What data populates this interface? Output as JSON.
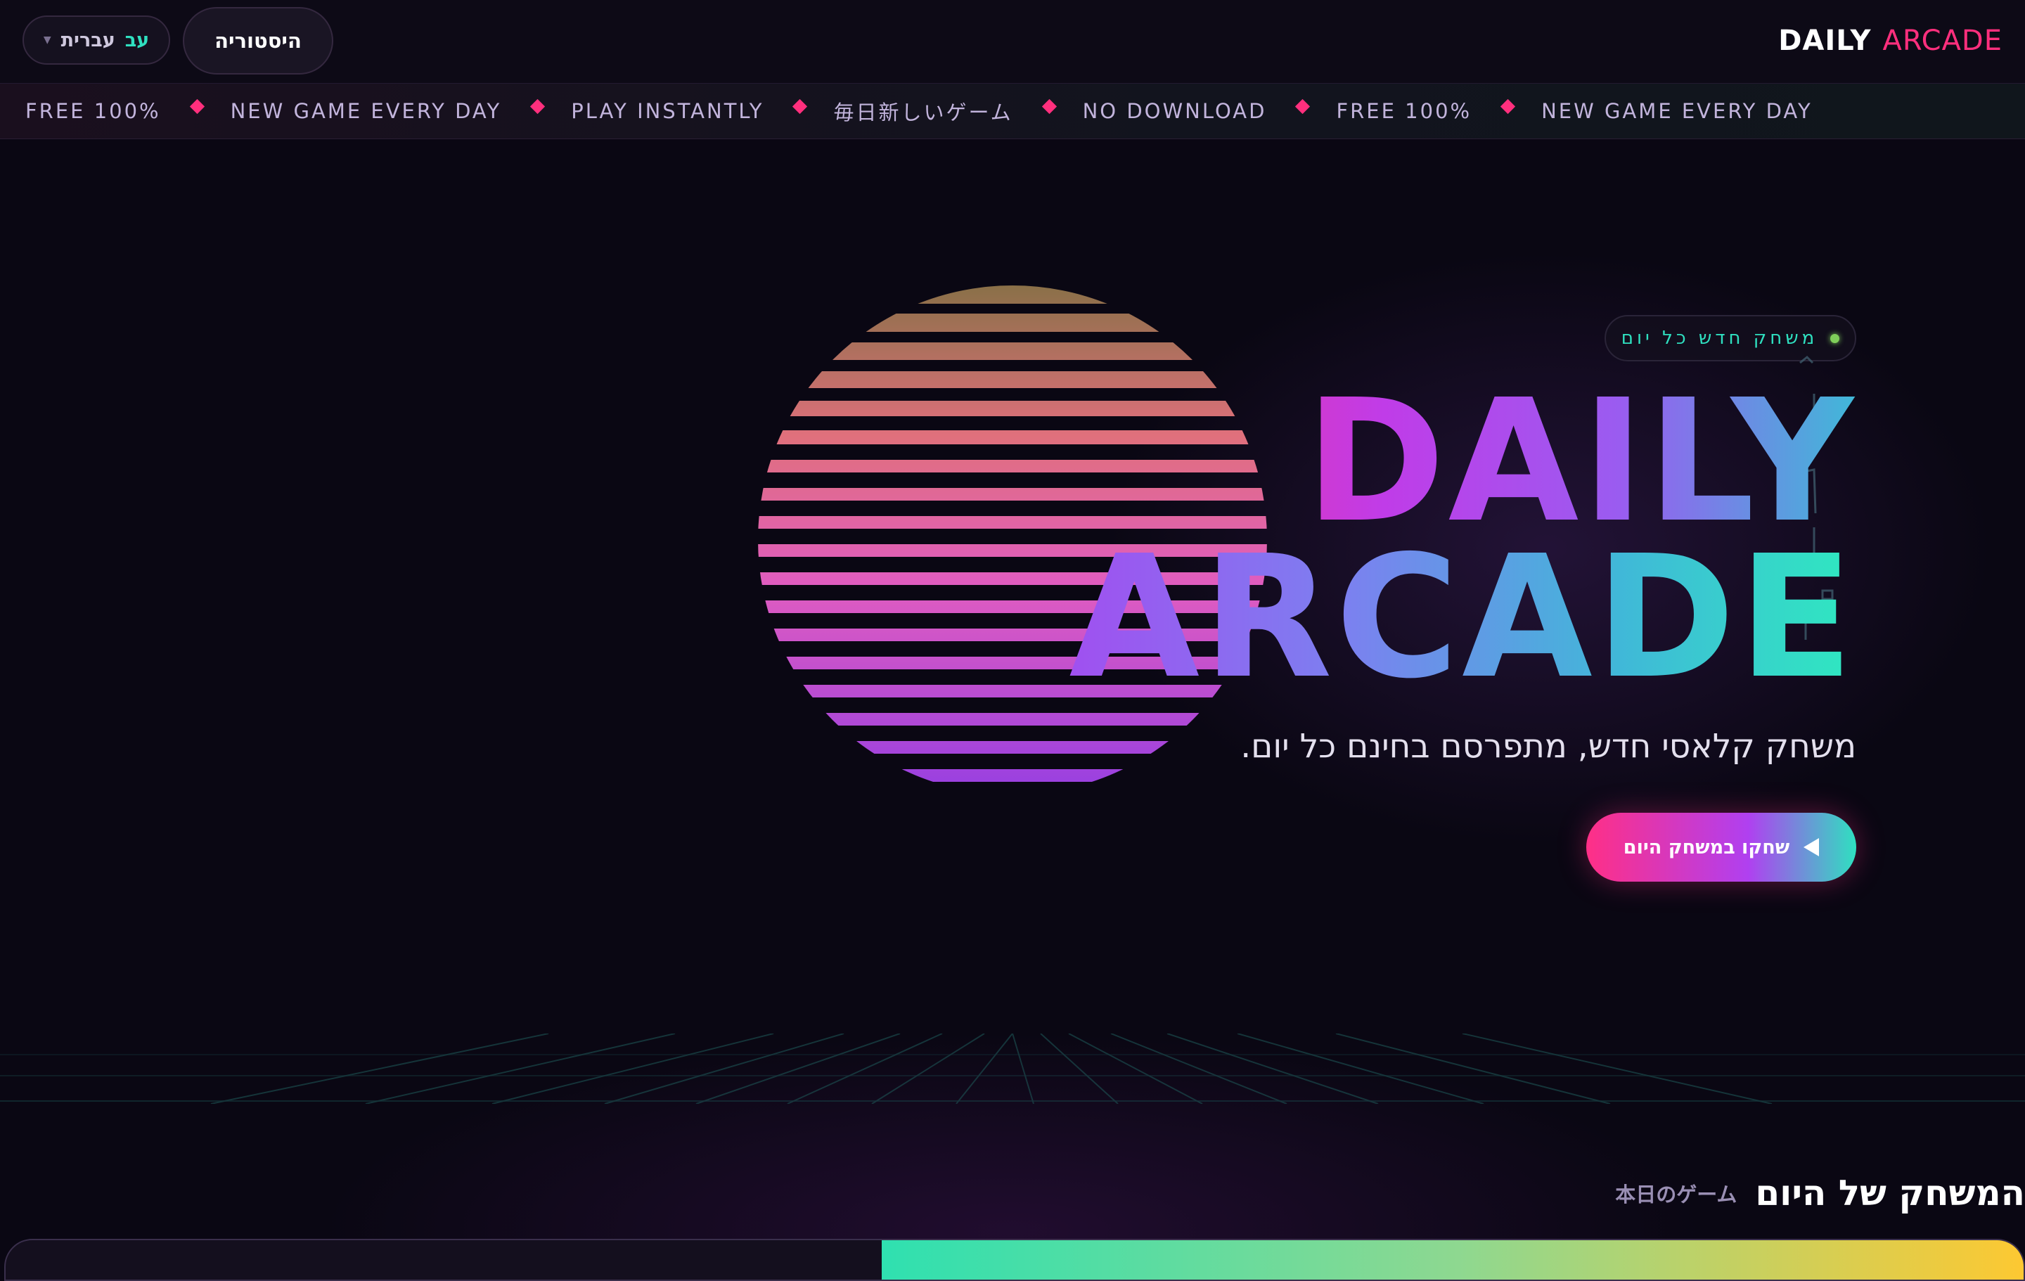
{
  "header": {
    "logo_word1": "DAILY",
    "logo_word2": "ARCADE",
    "history_label": "היסטוריה",
    "language": {
      "code": "עב",
      "label": "עברית"
    }
  },
  "ticker": {
    "items": [
      "FREE 100%",
      "NEW GAME EVERY DAY",
      "PLAY INSTANTLY",
      "毎日新しいゲーム",
      "NO DOWNLOAD",
      "FREE 100%",
      "NEW GAME EVERY DAY"
    ]
  },
  "hero": {
    "badge": "משחק חדש כל יום",
    "title_line1": "DAILY",
    "title_line2": "ARCADE",
    "subtitle": "משחק קלאסי חדש, מתפרסם בחינם כל יום.",
    "cta_label": "שחקו במשחק היום"
  },
  "section": {
    "heading": "המשחק של היום",
    "heading_jp": "本日のゲーム"
  },
  "colors": {
    "accent_pink": "#ff2f7d",
    "accent_teal": "#2fe0c0",
    "accent_purple": "#b040f0",
    "background": "#0a0713"
  },
  "icons": {
    "language_caret": "chevron-down-icon",
    "cta_icon": "play-icon",
    "ticker_separator": "diamond-icon",
    "badge_dot": "status-dot-icon"
  }
}
